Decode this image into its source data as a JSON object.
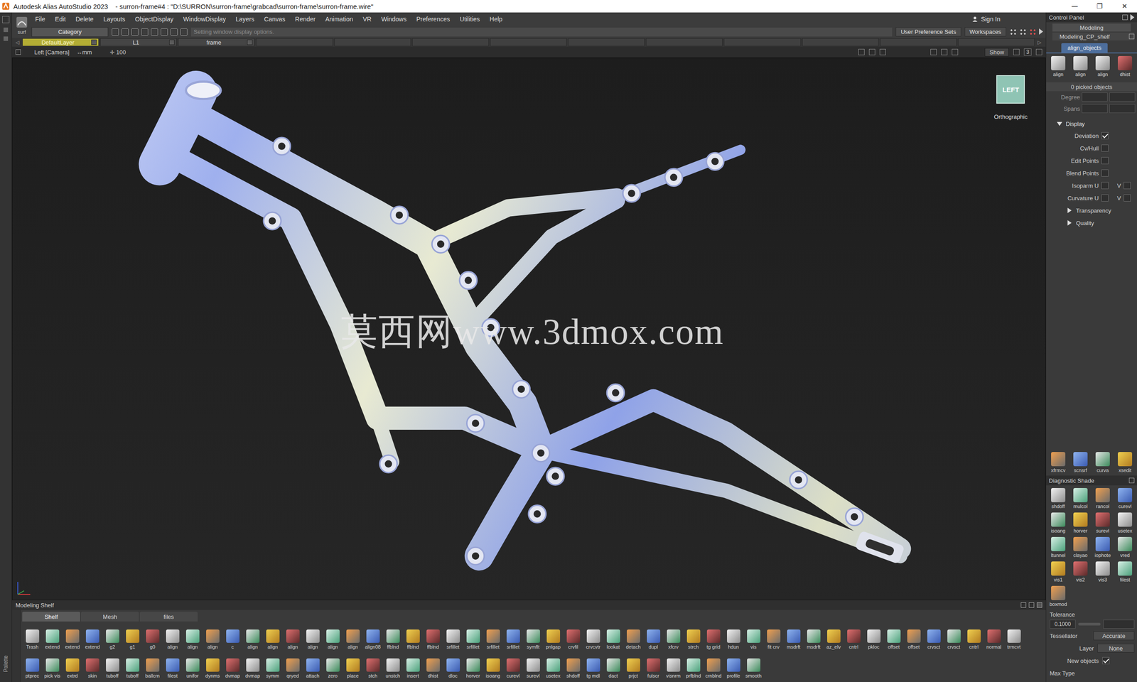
{
  "window": {
    "title": "Autodesk Alias AutoStudio 2023    - surron-frame#4 : \"D:\\SURRON\\surron-frame\\grabcad\\surron-frame\\surron-frame.wire\"",
    "controls": [
      "—",
      "❐",
      "✕"
    ]
  },
  "palette": "Palette",
  "menu": [
    "File",
    "Edit",
    "Delete",
    "Layouts",
    "ObjectDisplay",
    "WindowDisplay",
    "Layers",
    "Canvas",
    "Render",
    "Animation",
    "VR",
    "Windows",
    "Preferences",
    "Utilities",
    "Help"
  ],
  "toolbar": {
    "mode": "surf",
    "category": "Category",
    "hint": "Setting window display options.",
    "buttons": [
      "User Preference Sets",
      "Workspaces"
    ],
    "sign_in": "Sign In"
  },
  "layerbar": {
    "prev": "◁",
    "next": "▷",
    "layers": [
      {
        "label": "DefaultLayer",
        "selected": true
      },
      {
        "label": "L1",
        "selected": false
      },
      {
        "label": "frame",
        "selected": false
      }
    ]
  },
  "viewport": {
    "camera": "Left [Camera]",
    "units": "↔mm",
    "grid_icon": "✛",
    "grid": "100",
    "show": "Show",
    "count": "3",
    "view_cube": "LEFT",
    "projection": "Orthographic",
    "watermark": "莫西网www.3dmox.com"
  },
  "control_panel": {
    "title": "Control Panel",
    "workspace": "Modeling",
    "shelf_name": "Modeling_CP_shelf",
    "tab": {
      "label": "align_objects",
      "selected": true
    },
    "tools": [
      "align",
      "align",
      "align",
      "dhist"
    ],
    "picked": "0 picked objects",
    "fields": [
      "Degree",
      "Spans"
    ],
    "display": {
      "label": "Display",
      "expanded": true,
      "rows": [
        {
          "label": "Deviation",
          "checked": true,
          "v_label": "",
          "v_checked": false
        },
        {
          "label": "Cv/Hull",
          "checked": false,
          "v_label": "",
          "v_checked": false
        },
        {
          "label": "Edit Points",
          "checked": false,
          "v_label": "",
          "v_checked": false
        },
        {
          "label": "Blend Points",
          "checked": false,
          "v_label": "",
          "v_checked": false
        },
        {
          "label": "Isoparm U",
          "checked": false,
          "v_label": "V",
          "v_checked": false
        },
        {
          "label": "Curvature U",
          "checked": false,
          "v_label": "V",
          "v_checked": false
        }
      ],
      "sections": [
        {
          "label": "Transparency",
          "expanded": false
        },
        {
          "label": "Quality",
          "expanded": false
        }
      ]
    },
    "tools2": [
      "xfrmcv",
      "scnsrf",
      "curva",
      "xsedit"
    ],
    "diagnostic": {
      "title": "Diagnostic Shade",
      "tools": [
        "shdoff",
        "mulcol",
        "rancol",
        "curevl",
        "isoang",
        "horver",
        "surevl",
        "usetex",
        "ltunnel",
        "clayao",
        "iophote",
        "vred",
        "vis1",
        "vis2",
        "vis3",
        "filest",
        "boxmod"
      ]
    },
    "tolerance": {
      "label": "Tolerance",
      "value": "0.1000"
    },
    "tessellator": {
      "label": "Tessellator",
      "value": "Accurate"
    },
    "layer": {
      "label": "Layer",
      "value": "None"
    },
    "new_objects": {
      "label": "New objects",
      "checked": true
    },
    "max_type": "Max Type"
  },
  "shelf": {
    "title": "Modeling Shelf",
    "tabs": [
      {
        "label": "Shelf",
        "selected": true
      },
      {
        "label": "Mesh",
        "selected": false
      },
      {
        "label": "files",
        "selected": false
      }
    ],
    "rows": [
      [
        "Trash",
        "extend",
        "extend",
        "extend",
        "g2",
        "g1",
        "g0",
        "align",
        "align",
        "align",
        "c",
        "align",
        "align",
        "align",
        "align",
        "align",
        "align",
        "align08",
        "ffblnd",
        "ffblnd",
        "ffblnd",
        "srfillet",
        "srfillet",
        "srfillet",
        "srfillet",
        "symflt",
        "pnlgap",
        "crvfil",
        "crvcvtr",
        "lookat",
        "detach",
        "dupl",
        "xfcrv",
        "strch",
        "tg grid",
        "hdun",
        "vis",
        "fit crv",
        "msdrft",
        "msdrft",
        "az_elv",
        "cntrl",
        "pkloc",
        "offset",
        "offset",
        "crvsct",
        "crvsct",
        "cntrl",
        "normal",
        "trmcvt"
      ],
      [
        "ptprec",
        "pick vis",
        "extrd",
        "skin",
        "tuboff",
        "tuboff",
        "ballcrn",
        "filest",
        "unifor",
        "dynms",
        "dvmap",
        "dvmap",
        "symm",
        "qryed",
        "attach",
        "zero",
        "place",
        "stch",
        "unstch",
        "insert",
        "dhist",
        "dloc",
        "horver",
        "isoang",
        "curevl",
        "surevl",
        "usetex",
        "shdoff",
        "tg mdl",
        "dact",
        "prjct",
        "fulscr",
        "visnrm",
        "prfblnd",
        "crnblnd",
        "profile",
        "smooth"
      ]
    ]
  }
}
